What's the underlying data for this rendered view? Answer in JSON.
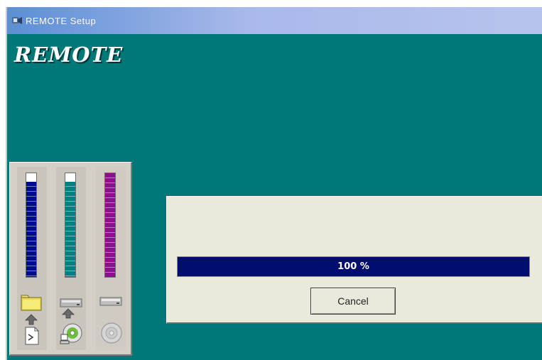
{
  "window": {
    "title": "REMOTE Setup",
    "icon": "setup-app-icon"
  },
  "logo": {
    "text": "REMOTE"
  },
  "meters": [
    {
      "name": "meter-1",
      "color": "#000c8a",
      "level": 0.92,
      "icons": [
        "folder-icon",
        "up-arrow-icon",
        "document-icon"
      ]
    },
    {
      "name": "meter-2",
      "color": "#008080",
      "level": 0.92,
      "icons": [
        "drive-icon",
        "up-arrow-icon",
        "computer-cd-icon"
      ]
    },
    {
      "name": "meter-3",
      "color": "#8b0f8f",
      "level": 1.0,
      "icons": [
        "drive-icon",
        "disc-icon"
      ]
    }
  ],
  "dialog": {
    "progress_percent": 100,
    "progress_label": "100 %",
    "cancel_label": "Cancel"
  },
  "colors": {
    "desktop_teal": "#007878",
    "progress_fill": "#000c6e",
    "dialog_bg": "#ebe9dc"
  }
}
